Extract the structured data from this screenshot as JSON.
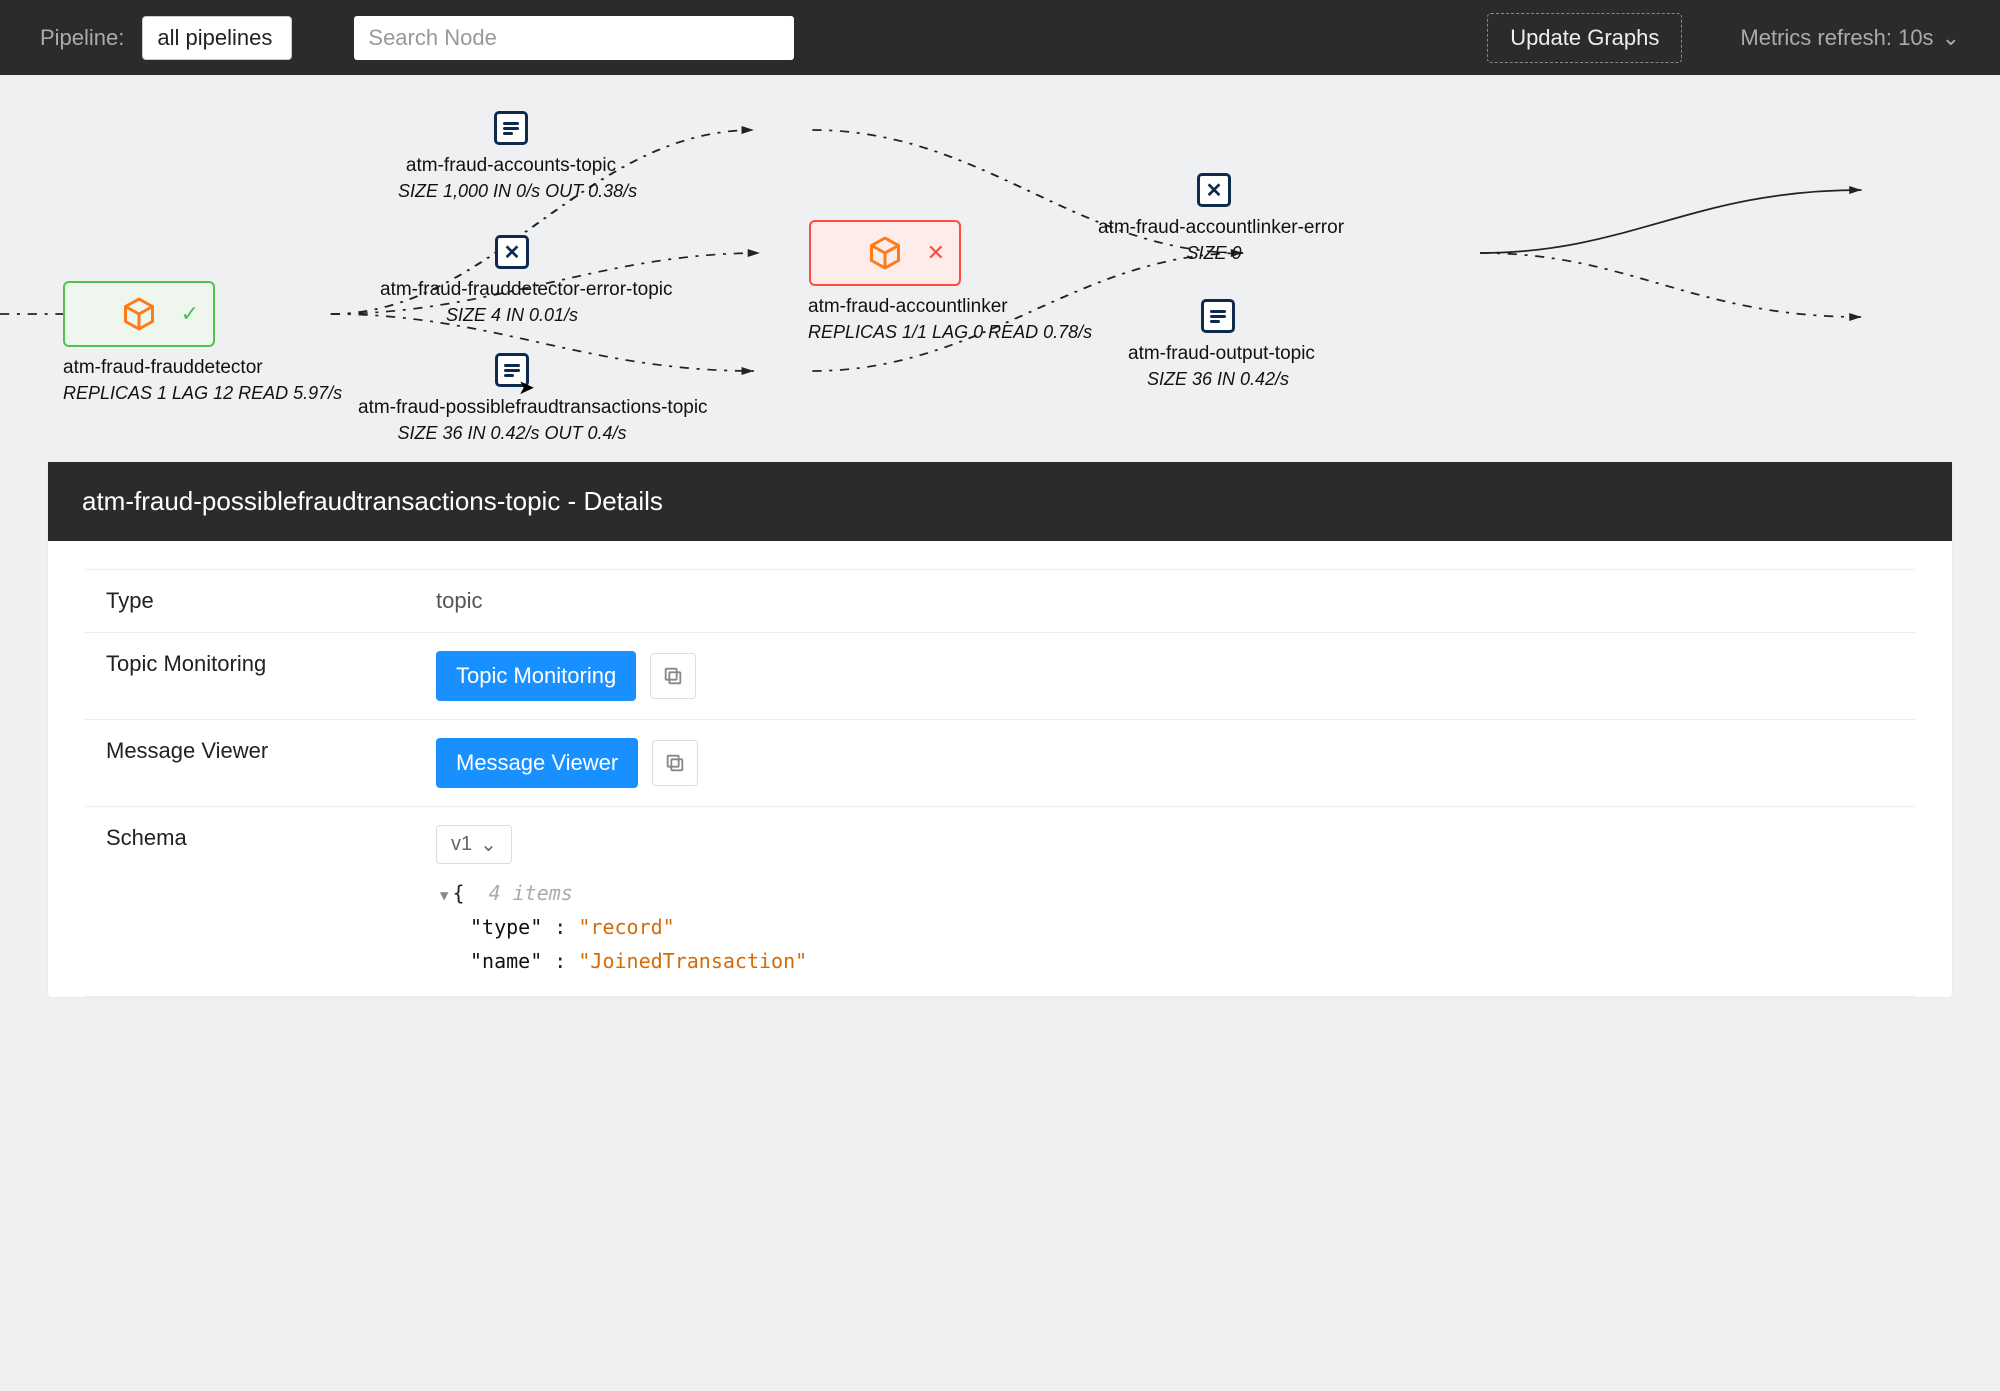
{
  "topbar": {
    "pipeline_label": "Pipeline:",
    "pipeline_value": "all pipelines",
    "search_placeholder": "Search Node",
    "update_label": "Update Graphs",
    "metrics_label": "Metrics refresh: 10s"
  },
  "graph": {
    "frauddetector": {
      "title": "atm-fraud-frauddetector",
      "subtitle": "REPLICAS 1  LAG 12  READ 5.97/s"
    },
    "accounts_topic": {
      "title": "atm-fraud-accounts-topic",
      "subtitle": "SIZE 1,000  IN 0/s  OUT 0.38/s"
    },
    "frauddetector_error_topic": {
      "title": "atm-fraud-frauddetector-error-topic",
      "subtitle": "SIZE 4  IN 0.01/s"
    },
    "possiblefraud_topic": {
      "title": "atm-fraud-possiblefraudtransactions-topic",
      "subtitle": "SIZE 36  IN 0.42/s  OUT 0.4/s"
    },
    "accountlinker": {
      "title": "atm-fraud-accountlinker",
      "subtitle": "REPLICAS 1/1  LAG 0  READ 0.78/s"
    },
    "accountlinker_error": {
      "title": "atm-fraud-accountlinker-error",
      "subtitle": "SIZE 0"
    },
    "output_topic": {
      "title": "atm-fraud-output-topic",
      "subtitle": "SIZE 36  IN 0.42/s"
    }
  },
  "details": {
    "header": "atm-fraud-possiblefraudtransactions-topic - Details",
    "rows": {
      "type_key": "Type",
      "type_val": "topic",
      "monitoring_key": "Topic Monitoring",
      "monitoring_btn": "Topic Monitoring",
      "viewer_key": "Message Viewer",
      "viewer_btn": "Message Viewer",
      "schema_key": "Schema",
      "schema_version": "v1",
      "schema_items_meta": "4 items",
      "schema_type_key": "\"type\"",
      "schema_type_val": "\"record\"",
      "schema_name_key": "\"name\"",
      "schema_name_val": "\"JoinedTransaction\""
    }
  }
}
